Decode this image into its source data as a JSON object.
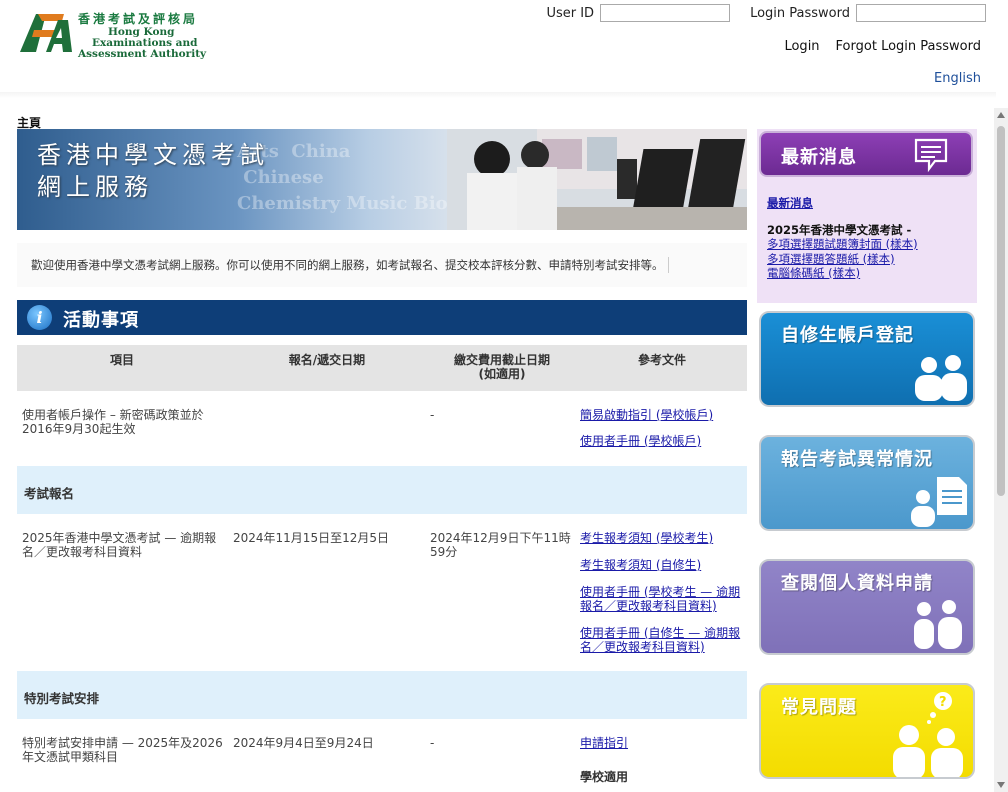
{
  "header": {
    "logo": {
      "name_zh": "香港考試及評核局",
      "name_en_line1": "Hong Kong",
      "name_en_line2": "Examinations and",
      "name_en_line3": "Assessment Authority"
    },
    "login": {
      "user_id_label": "User ID",
      "user_id_value": "",
      "password_label": "Login Password",
      "password_value": "",
      "login_link": "Login",
      "forgot_link": "Forgot Login Password"
    },
    "language_link": "English"
  },
  "breadcrumb": "主頁",
  "banner": {
    "title_line1": "香港中學文憑考試",
    "title_line2": "網上服務"
  },
  "welcome_text": "歡迎使用香港中學文憑考試網上服務。你可以使用不同的網上服務，如考試報名、提交校本評核分數、申請特別考試安排等。",
  "activities": {
    "title": "活動事項",
    "columns": [
      "項目",
      "報名/遞交日期",
      "繳交費用截止日期",
      "(如適用)",
      "參考文件"
    ],
    "row1": {
      "item_line1": "使用者帳戶操作 – 新密碼政策並於",
      "item_line2": "2016年9月30起生效",
      "fee": "-",
      "doc1": "簡易啟動指引 (學校帳戶)",
      "doc2": "使用者手冊 (學校帳戶)"
    },
    "section_exam": "考試報名",
    "row2": {
      "item_line1": "2025年香港中學文憑考試 — 逾期報",
      "item_line2": "名／更改報考科目資料",
      "date": "2024年11月15日至12月5日",
      "fee_line1": "2024年12月9日下午11時",
      "fee_line2": "59分",
      "doc1": "考生報考須知 (學校考生)",
      "doc2": "考生報考須知 (自修生)",
      "doc3_line1": "使用者手冊 (學校考生 — 逾期",
      "doc3_line2": "報名／更改報考科目資料)",
      "doc4_line1": "使用者手冊 (自修生 — 逾期報",
      "doc4_line2": "名／更改報考科目資料)"
    },
    "section_special": "特別考試安排",
    "row3": {
      "item_line1": "特別考試安排申請 — 2025年及2026",
      "item_line2": "年文憑試甲類科目",
      "date": "2024年9月4日至9月24日",
      "fee": "-",
      "doc1": "申請指引",
      "doc2": "學校適用"
    }
  },
  "news": {
    "header": "最新消息",
    "link_title": "最新消息",
    "subtitle": "2025年香港中學文憑考試 -",
    "links": [
      "多項選擇題試題簿封面 (樣本)",
      "多項選擇題答題紙 (樣本)",
      "電腦條碼紙 (樣本)"
    ]
  },
  "tiles": {
    "private_candidate": "自修生帳戶登記",
    "report_irregularity": "報告考試異常情況",
    "personal_data": "查閱個人資料申請",
    "faq": "常見問題"
  },
  "colors": {
    "activities_header": "#0e3e78",
    "section_bg": "#dff0fb",
    "news_bg": "#efe1f6",
    "news_head": "#7a2fa3",
    "tile_blue": "#1480c8",
    "tile_lightblue": "#5fa8d8",
    "tile_purple": "#8a7bc0",
    "tile_yellow": "#f7e600",
    "link": "#1a1aa8"
  }
}
